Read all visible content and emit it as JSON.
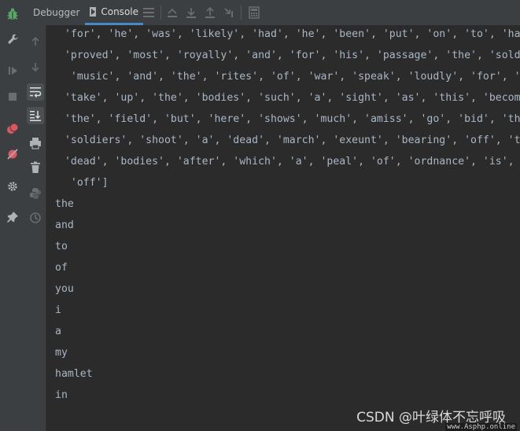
{
  "tabs": {
    "debugger": "Debugger",
    "console": "Console"
  },
  "console_lines": [
    " 'for', 'he', 'was', 'likely', 'had', 'he', 'been', 'put', 'on', 'to', 'have',",
    " 'proved', 'most', 'royally', 'and', 'for', 'his', 'passage', 'the', 'soldiers'",
    "  'music', 'and', 'the', 'rites', 'of', 'war', 'speak', 'loudly', 'for', 'him',",
    " 'take', 'up', 'the', 'bodies', 'such', 'a', 'sight', 'as', 'this', 'becomes',",
    " 'the', 'field', 'but', 'here', 'shows', 'much', 'amiss', 'go', 'bid', 'the',",
    " 'soldiers', 'shoot', 'a', 'dead', 'march', 'exeunt', 'bearing', 'off', 'the',",
    " 'dead', 'bodies', 'after', 'which', 'a', 'peal', 'of', 'ordnance', 'is', 'shot",
    "  'off']",
    "the",
    "and",
    "to",
    "of",
    "you",
    "i",
    "a",
    "my",
    "hamlet",
    "in"
  ],
  "watermark": "CSDN @叶绿体不忘呼吸",
  "watermark_url": "www.Asphp.online",
  "colors": {
    "background": "#2b2b2b",
    "panel": "#3c3f41",
    "text": "#a9b7c6",
    "accent": "#4a88c7",
    "bug_green": "#59a869",
    "debug_red": "#db5860"
  }
}
